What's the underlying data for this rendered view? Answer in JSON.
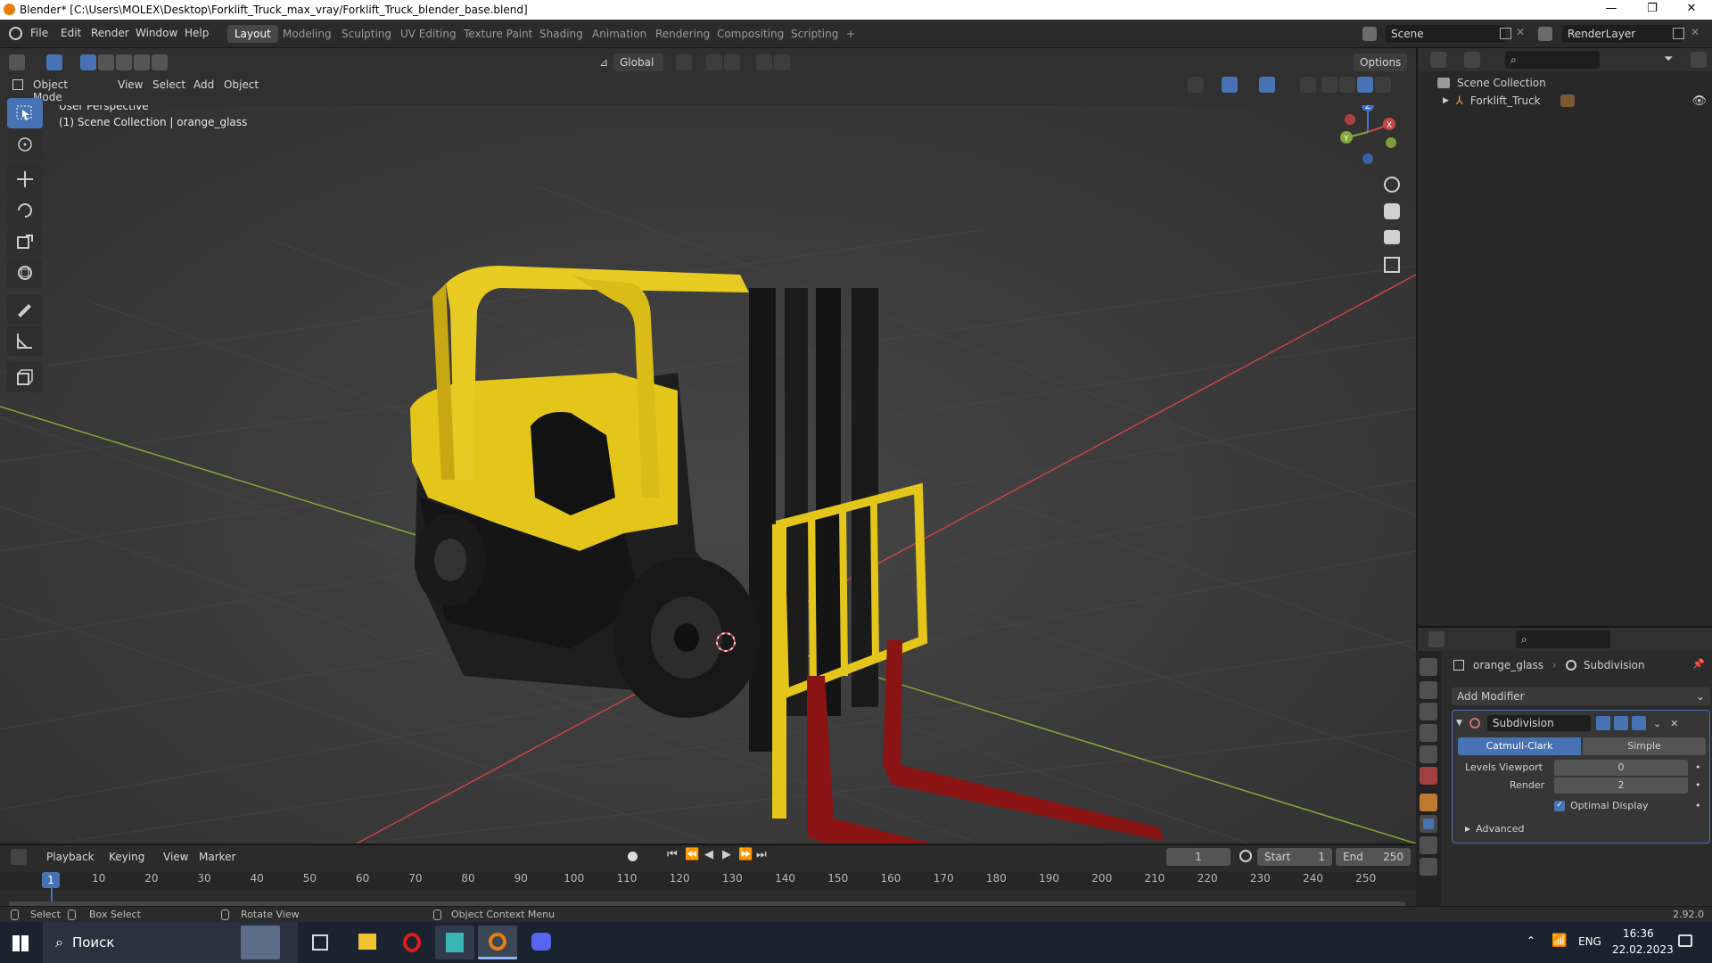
{
  "window": {
    "title": "Blender* [C:\\Users\\MOLEX\\Desktop\\Forklift_Truck_max_vray/Forklift_Truck_blender_base.blend]",
    "controls": [
      "—",
      "❐",
      "✕"
    ]
  },
  "menu": [
    "File",
    "Edit",
    "Render",
    "Window",
    "Help"
  ],
  "workspaces": [
    {
      "label": "Layout",
      "active": true
    },
    {
      "label": "Modeling"
    },
    {
      "label": "Sculpting"
    },
    {
      "label": "UV Editing"
    },
    {
      "label": "Texture Paint"
    },
    {
      "label": "Shading"
    },
    {
      "label": "Animation"
    },
    {
      "label": "Rendering"
    },
    {
      "label": "Compositing"
    },
    {
      "label": "Scripting"
    },
    {
      "label": "+"
    }
  ],
  "scene": {
    "name": "Scene",
    "render_layer": "RenderLayer"
  },
  "viewport_header": {
    "mode": "Object Mode",
    "menus": [
      "View",
      "Select",
      "Add",
      "Object"
    ],
    "transform_orientation": "Global",
    "options_label": "Options"
  },
  "viewport": {
    "perspective_label": "User Perspective",
    "collection_label": "(1) Scene Collection | orange_glass",
    "gizmo_axes": {
      "x": "X",
      "y": "Y",
      "z": "Z"
    }
  },
  "colors": {
    "accent_blue": "#4772b3",
    "axis_red": "#c84545",
    "axis_green": "#84a83a",
    "axis_blue": "#3b75d6",
    "forklift_yellow": "#e4c61b",
    "fork_red": "#8a1414"
  },
  "outliner": {
    "root": "Scene Collection",
    "items": [
      {
        "label": "Forklift_Truck"
      }
    ]
  },
  "properties": {
    "object_name": "orange_glass",
    "modifier_tab_label": "Subdivision",
    "add_modifier": "Add Modifier",
    "modifier": {
      "name": "Subdivision",
      "algorithms": [
        "Catmull-Clark",
        "Simple"
      ],
      "active_algorithm": "Catmull-Clark",
      "levels_viewport_label": "Levels Viewport",
      "levels_viewport": "0",
      "render_label": "Render",
      "render_levels": "2",
      "optimal_display_label": "Optimal Display",
      "optimal_display": true,
      "advanced_label": "Advanced"
    }
  },
  "timeline": {
    "menus": [
      "Playback",
      "Keying",
      "View",
      "Marker"
    ],
    "current_frame": "1",
    "start_label": "Start",
    "start": "1",
    "end_label": "End",
    "end": "250",
    "ruler_current": "1",
    "ruler": [
      "10",
      "20",
      "30",
      "40",
      "50",
      "60",
      "70",
      "80",
      "90",
      "100",
      "110",
      "120",
      "130",
      "140",
      "150",
      "160",
      "170",
      "180",
      "190",
      "200",
      "210",
      "220",
      "230",
      "240",
      "250"
    ]
  },
  "statusbar": {
    "select": "Select",
    "box_select": "Box Select",
    "rotate_view": "Rotate View",
    "context_menu": "Object Context Menu",
    "version": "2.92.0"
  },
  "taskbar": {
    "search": "Поиск",
    "lang": "ENG",
    "time": "16:36",
    "date": "22.02.2023"
  }
}
